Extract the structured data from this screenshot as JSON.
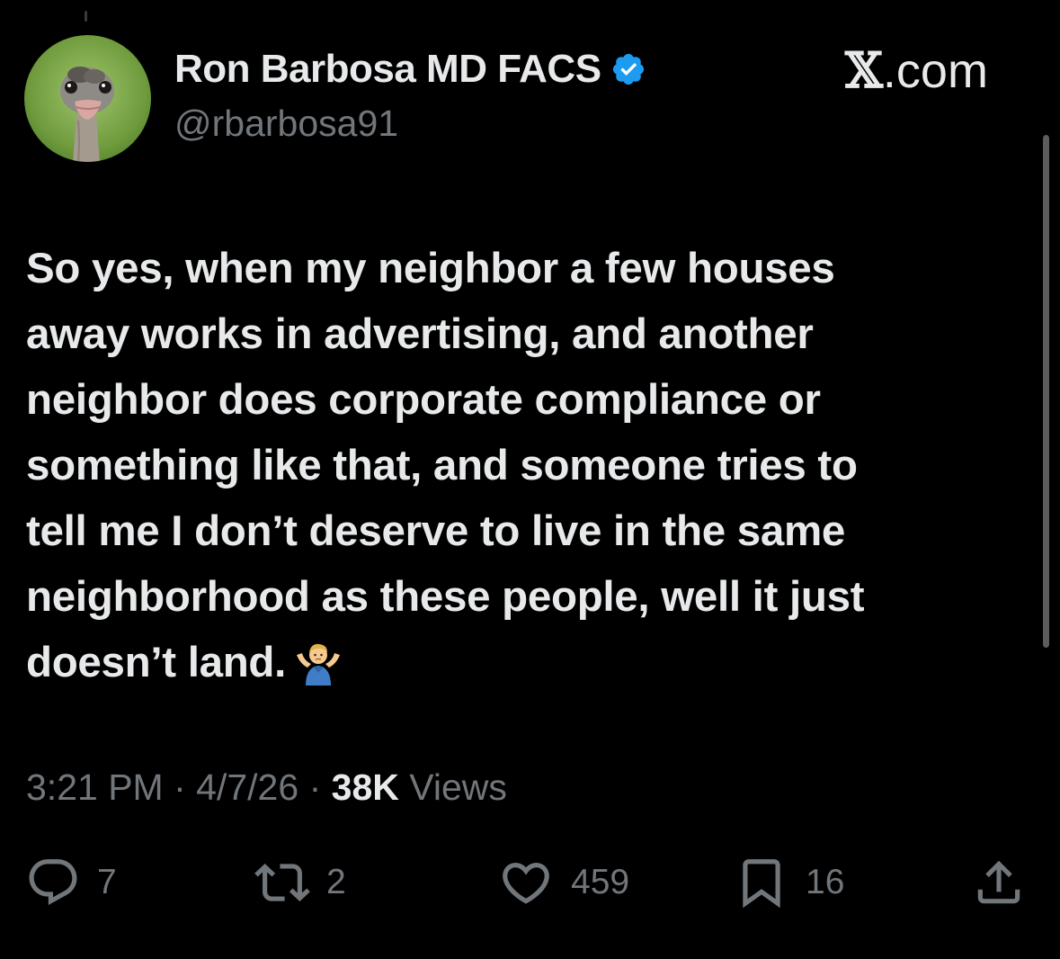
{
  "author": {
    "display_name": "Ron Barbosa MD FACS",
    "handle": "@rbarbosa91",
    "verified": true,
    "avatar_icon": "ostrich-avatar-icon"
  },
  "site": {
    "logo_glyph": "𝕏",
    "suffix": ".com"
  },
  "tweet": {
    "lines": [
      "So yes, when my neighbor a few houses",
      "away works in advertising, and another",
      "neighbor does corporate compliance or",
      "something like that, and someone tries to",
      "tell me I don’t deserve to live in the same",
      "neighborhood as these people, well it just",
      "doesn’t land."
    ],
    "emoji": "man-shrugging-emoji"
  },
  "meta": {
    "time": "3:21 PM",
    "separator": "·",
    "date": "4/7/26",
    "views_count": "38K",
    "views_label": "Views"
  },
  "actions": {
    "replies": "7",
    "reposts": "2",
    "likes": "459",
    "bookmarks": "16"
  },
  "colors": {
    "background": "#000000",
    "text_primary": "#e7e9ea",
    "text_secondary": "#71767b",
    "verified_blue": "#1d9bf0"
  }
}
